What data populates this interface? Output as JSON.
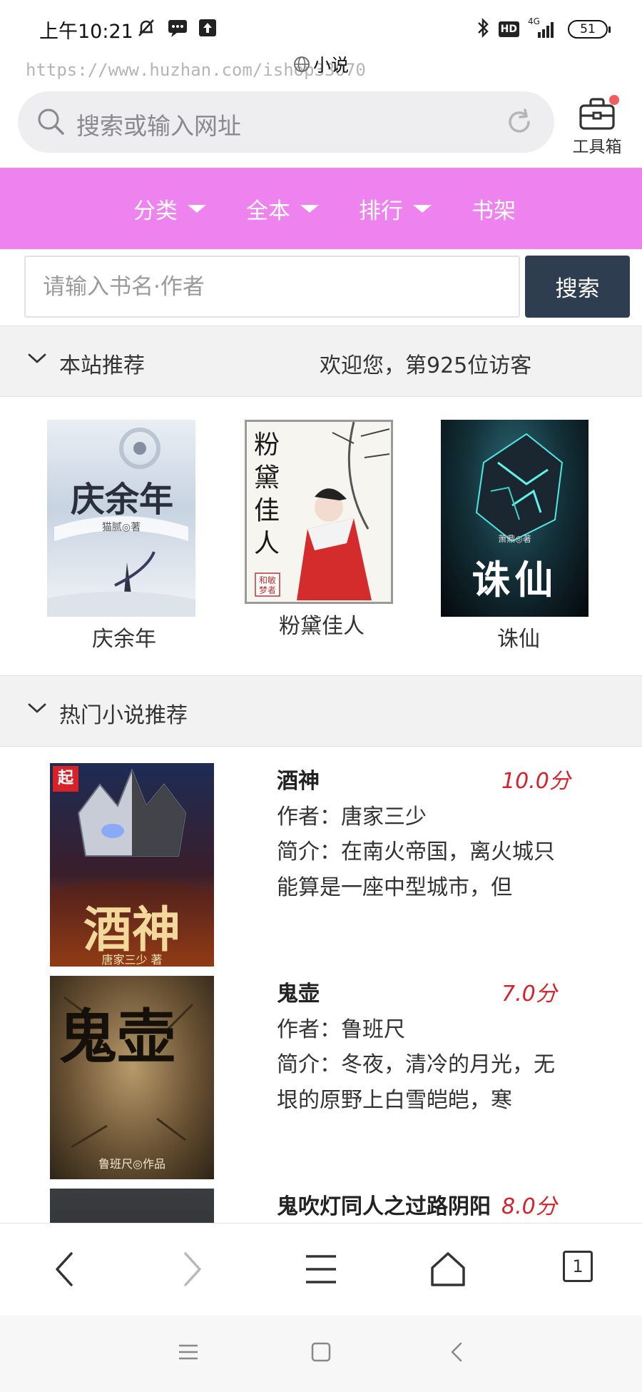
{
  "status_bar": {
    "time": "上午10:21",
    "network": "4G",
    "hd_label": "HD",
    "battery": "51"
  },
  "page": {
    "title": "小说",
    "url_watermark": "https://www.huzhan.com/ishop33070"
  },
  "browser": {
    "address_placeholder": "搜索或输入网址",
    "toolbox_label": "工具箱",
    "tabs_count": "1"
  },
  "nav": {
    "items": [
      {
        "label": "分类",
        "has_caret": true
      },
      {
        "label": "全本",
        "has_caret": true
      },
      {
        "label": "排行",
        "has_caret": true
      },
      {
        "label": "书架",
        "has_caret": false
      }
    ]
  },
  "search": {
    "placeholder": "请输入书名·作者",
    "button_label": "搜索"
  },
  "recommend": {
    "title": "本站推荐",
    "visitor_text": "欢迎您，第925位访客",
    "books": [
      {
        "title": "庆余年",
        "cover_text": "庆余年",
        "cover_author": "猫腻◎著"
      },
      {
        "title": "粉黛佳人",
        "cover_text": "粉黛佳人",
        "cover_author": "和敏梦者"
      },
      {
        "title": "诛仙",
        "cover_text": "诛仙",
        "cover_author": "萧鼎◎著"
      }
    ]
  },
  "hot": {
    "title": "热门小说推荐",
    "books": [
      {
        "name": "酒神",
        "score": "10.0分",
        "author": "作者：唐家三少",
        "intro": "简介：在南火帝国，离火城只能算是一座中型城市，但",
        "cover_text": "酒神",
        "cover_sub": "唐家三少 著",
        "cover_badge": "起"
      },
      {
        "name": "鬼壶",
        "score": "7.0分",
        "author": "作者：鲁班尺",
        "intro": "简介：冬夜，清冷的月光，无垠的原野上白雪皑皑，寒",
        "cover_text": "鬼壶",
        "cover_sub": "鲁班尺◎作品"
      },
      {
        "name": "鬼吹灯同人之过路阴阳",
        "score": "8.0分",
        "author": "",
        "intro": ""
      }
    ]
  },
  "colors": {
    "nav_bg": "#ee82ee",
    "search_btn_bg": "#2e3d50",
    "score": "#d4232b"
  }
}
